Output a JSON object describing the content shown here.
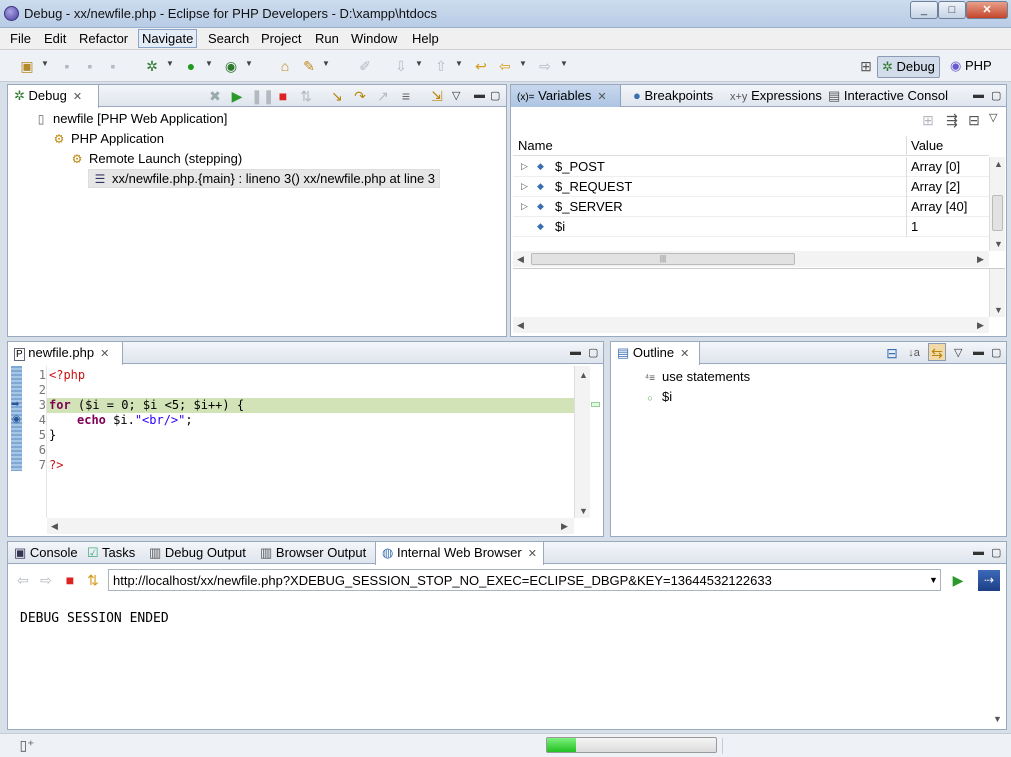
{
  "window": {
    "title": "Debug - xx/newfile.php - Eclipse for PHP Developers - D:\\xampp\\htdocs"
  },
  "menu": [
    "File",
    "Edit",
    "Refactor",
    "Navigate",
    "Search",
    "Project",
    "Run",
    "Window",
    "Help"
  ],
  "perspectives": {
    "debug": "Debug",
    "php": "PHP"
  },
  "debug_view": {
    "tab": "Debug",
    "tree": [
      "newfile [PHP Web Application]",
      "PHP Application",
      "Remote Launch (stepping)",
      "xx/newfile.php.{main} : lineno 3() xx/newfile.php at line 3"
    ]
  },
  "variables_view": {
    "tabs": [
      "Variables",
      "Breakpoints",
      "Expressions",
      "Interactive Consol"
    ],
    "columns": {
      "name": "Name",
      "value": "Value"
    },
    "rows": [
      {
        "name": "$_POST",
        "value": "Array [0]"
      },
      {
        "name": "$_REQUEST",
        "value": "Array [2]"
      },
      {
        "name": "$_SERVER",
        "value": "Array [40]"
      },
      {
        "name": "$i",
        "value": "1"
      }
    ]
  },
  "editor": {
    "tab": "newfile.php",
    "line_numbers": [
      "1",
      "2",
      "3",
      "4",
      "5",
      "6",
      "7"
    ],
    "lines": {
      "l1": "<?php",
      "l3_kw": "for",
      "l3_rest": " ($i = 0; $i <5; $i++) {",
      "l4_kw": "echo",
      "l4_var": " $i.",
      "l4_str": "\"<br/>\"",
      "l4_end": ";",
      "l5": "}",
      "l7": "?>"
    }
  },
  "outline_view": {
    "tab": "Outline",
    "items": [
      "use statements",
      "$i"
    ]
  },
  "bottom_view": {
    "tabs": [
      "Console",
      "Tasks",
      "Debug Output",
      "Browser Output",
      "Internal Web Browser"
    ],
    "url": "http://localhost/xx/newfile.php?XDEBUG_SESSION_STOP_NO_EXEC=ECLIPSE_DBGP&KEY=13644532122633",
    "content": "DEBUG SESSION ENDED"
  },
  "status": {
    "progress": 0.17
  },
  "colors": {
    "highlight_line": "#d2e3b8",
    "tab_active": "#c8d8ee",
    "progress": "#22c022"
  }
}
